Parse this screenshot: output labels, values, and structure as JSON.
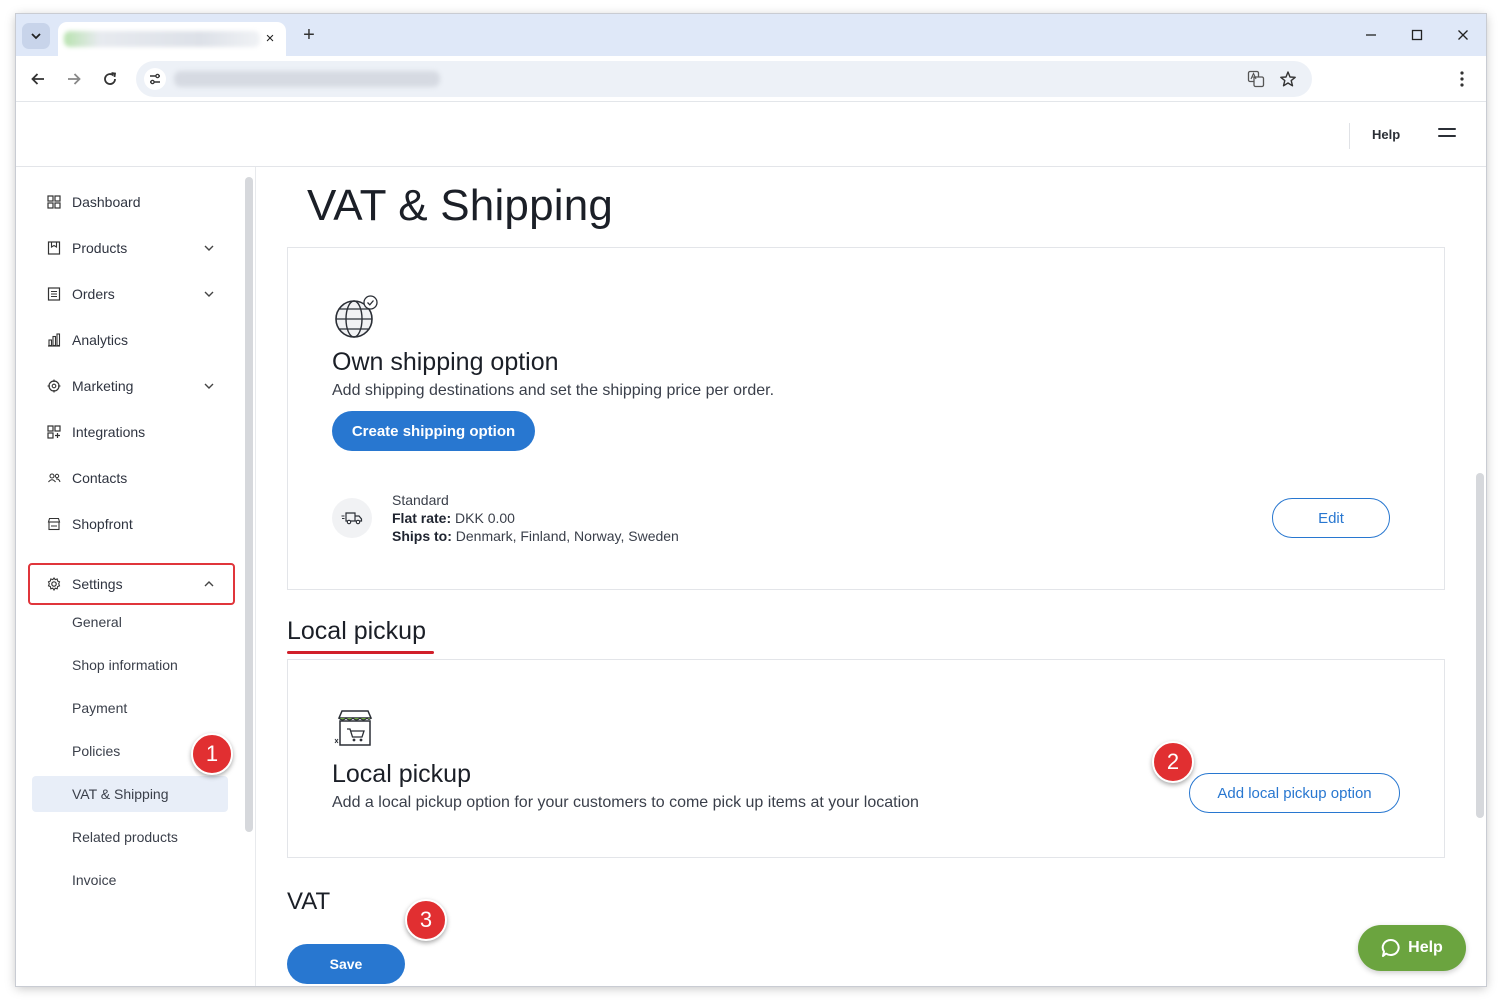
{
  "browser": {
    "tab_close_glyph": "×",
    "new_tab_glyph": "+"
  },
  "header": {
    "help_label": "Help"
  },
  "sidebar": {
    "items": [
      {
        "label": "Dashboard",
        "icon": "dashboard-icon"
      },
      {
        "label": "Products",
        "icon": "products-icon"
      },
      {
        "label": "Orders",
        "icon": "orders-icon"
      },
      {
        "label": "Analytics",
        "icon": "analytics-icon"
      },
      {
        "label": "Marketing",
        "icon": "marketing-icon"
      },
      {
        "label": "Integrations",
        "icon": "integrations-icon"
      },
      {
        "label": "Contacts",
        "icon": "contacts-icon"
      },
      {
        "label": "Shopfront",
        "icon": "shopfront-icon"
      },
      {
        "label": "Settings",
        "icon": "gear-icon"
      }
    ],
    "settings_sub": [
      {
        "label": "General"
      },
      {
        "label": "Shop information"
      },
      {
        "label": "Payment"
      },
      {
        "label": "Policies"
      },
      {
        "label": "VAT & Shipping"
      },
      {
        "label": "Related products"
      },
      {
        "label": "Invoice"
      }
    ]
  },
  "main": {
    "page_title": "VAT & Shipping",
    "own_shipping": {
      "title": "Own shipping option",
      "description": "Add shipping destinations and set the shipping price per order.",
      "create_button": "Create shipping option",
      "option": {
        "name": "Standard",
        "flat_rate_label": "Flat rate:",
        "flat_rate_value": "DKK 0.00",
        "ships_to_label": "Ships to:",
        "ships_to_value": "Denmark, Finland, Norway, Sweden"
      },
      "edit_button": "Edit"
    },
    "local_pickup_heading": "Local pickup",
    "local_pickup": {
      "title": "Local pickup",
      "description": "Add a local pickup option for your customers to come pick up items at your location",
      "add_button": "Add local pickup option"
    },
    "vat_heading": "VAT",
    "save_button": "Save"
  },
  "annotations": {
    "badge_1": "1",
    "badge_2": "2",
    "badge_3": "3",
    "highlight_color": "#e0353b"
  },
  "help_fab": {
    "label": "Help"
  },
  "colors": {
    "primary": "#2877d0",
    "help_fab": "#6ba43f",
    "badge": "#e12f31",
    "active_bg": "#e8eef8"
  }
}
